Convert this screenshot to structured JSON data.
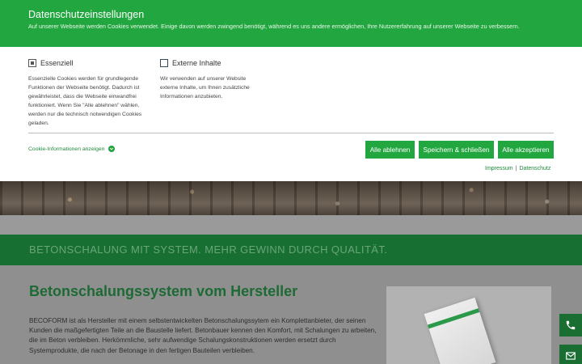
{
  "cookie_banner": {
    "title": "Datenschutzeinstellungen",
    "intro": "Auf unserer Webseite werden Cookies verwendet. Einige davon werden zwingend benötigt, während es uns andere ermöglichen, Ihre Nutzererfahrung auf unserer Webseite zu verbessern.",
    "categories": [
      {
        "label": "Essenziell",
        "checked": true,
        "description": "Essenzielle Cookies werden für grundlegende Funktionen der Webseite benötigt. Dadurch ist gewährleistet, dass die Webseite einwandfrei funktioniert. Wenn Sie \"Alle ablehnen\" wählen, werden nur die technisch notwendigen Cookies geladen."
      },
      {
        "label": "Externe Inhalte",
        "checked": false,
        "description": "Wir verwenden auf unserer Website externe Inhalte, um Ihnen zusätzliche Informationen anzubieten."
      }
    ],
    "info_link": "Cookie-Informationen anzeigen",
    "buttons": {
      "reject_all": "Alle ablehnen",
      "save_close": "Speichern & schließen",
      "accept_all": "Alle akzeptieren"
    },
    "footer_links": {
      "imprint": "Impressum",
      "separator": "|",
      "privacy": "Datenschutz"
    },
    "colors": {
      "accent": "#22a63f",
      "link": "#1f8a3a"
    }
  },
  "page": {
    "tagline": "BETONSCHALUNG MIT SYSTEM. MEHR GEWINN DURCH QUALITÄT.",
    "heading": "Betonschalungssystem vom Hersteller",
    "body": "BECOFORM ist als Hersteller mit einem selbstentwickelten Betonschalungssytem ein Komplettanbieter, der seinen Kunden die maßgefertigten Teile an die Baustelle liefert. Betonbauer kennen den Komfort, mit Schalungen zu arbeiten, die im Beton verbleiben. Herkömmliche, sehr aufwendige Schalungskonstruktionen werden ersetzt durch Systemprodukte, die nach der Betonage in den fertigen Bauteilen verbleiben.",
    "side_buttons": [
      "phone-icon",
      "mail-icon"
    ]
  }
}
